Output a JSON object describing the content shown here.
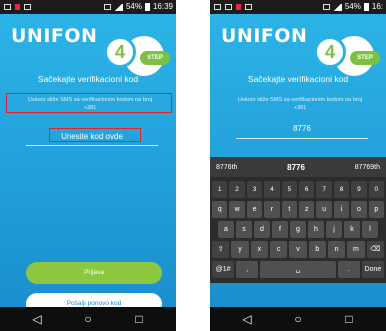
{
  "status": {
    "battery": "54%",
    "time": "16:39",
    "time_right": "16:"
  },
  "app": {
    "logo": "UNIFON",
    "step_number": "4",
    "step_label": "STEP"
  },
  "verify": {
    "title": "Sačekajte verifikacioni kod",
    "sms_text": "Uskoro stiže SMS sa verifikacionim kodom na broj",
    "phone_prefix": "+381",
    "code_placeholder": "Unesite kod ovde",
    "code_value": "8776"
  },
  "buttons": {
    "submit": "Prijava",
    "resend": "Pošalji ponovo kod"
  },
  "keyboard": {
    "suggestions": [
      "8776th",
      "8776",
      "87769th"
    ],
    "row_numbers": [
      "1",
      "2",
      "3",
      "4",
      "5",
      "6",
      "7",
      "8",
      "9",
      "0"
    ],
    "row1": [
      "q",
      "w",
      "e",
      "r",
      "t",
      "z",
      "u",
      "i",
      "o",
      "p"
    ],
    "row2": [
      "a",
      "s",
      "d",
      "f",
      "g",
      "h",
      "j",
      "k",
      "l"
    ],
    "row3": [
      "⇧",
      "y",
      "x",
      "c",
      "v",
      "b",
      "n",
      "m",
      "⌫"
    ],
    "row4": [
      "@1#",
      ",",
      "␣",
      ".",
      "Done"
    ]
  },
  "colors": {
    "primary_blue": "#2cb3e6",
    "accent_green": "#8dc63f",
    "highlight_red": "#e3212b"
  }
}
